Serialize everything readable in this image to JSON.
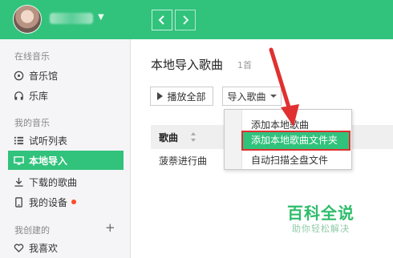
{
  "header": {
    "caret": "▼"
  },
  "sidebar": {
    "section_online": "在线音乐",
    "section_mine": "我的音乐",
    "section_created": "我创建的",
    "plus": "+",
    "items": [
      {
        "label": "音乐馆",
        "icon": "disc-icon"
      },
      {
        "label": "乐库",
        "icon": "headphones-icon"
      },
      {
        "label": "试听列表",
        "icon": "list-icon"
      },
      {
        "label": "本地导入",
        "icon": "monitor-icon"
      },
      {
        "label": "下载的歌曲",
        "icon": "download-icon"
      },
      {
        "label": "我的设备",
        "icon": "device-icon"
      },
      {
        "label": "我喜欢",
        "icon": "heart-icon"
      }
    ]
  },
  "main": {
    "title": "本地导入歌曲",
    "count": "1首",
    "play_all": "播放全部",
    "import": "导入歌曲",
    "table": {
      "col_song": "歌曲",
      "rows": [
        "菠萘进行曲"
      ]
    }
  },
  "menu": {
    "items": [
      "添加本地歌曲",
      "添加本地歌曲文件夹",
      "自动扫描全盘文件"
    ]
  },
  "watermark": {
    "main": "百科全说",
    "sub": "助你轻松解决"
  },
  "colors": {
    "accent": "#31c27c",
    "annotation": "#e03030"
  }
}
